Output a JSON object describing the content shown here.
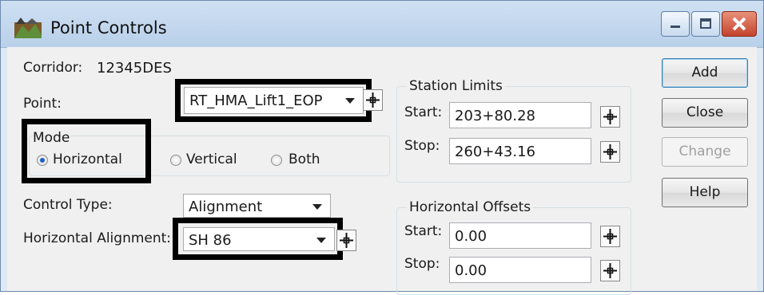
{
  "window": {
    "title": "Point Controls",
    "icon": "microstation-terrain-icon"
  },
  "corridor": {
    "label": "Corridor:",
    "value": "12345DES"
  },
  "point": {
    "label": "Point:",
    "value": "RT_HMA_Lift1_EOP"
  },
  "mode": {
    "title": "Mode",
    "options": [
      "Horizontal",
      "Vertical",
      "Both"
    ],
    "selected": "Horizontal"
  },
  "control_type": {
    "label": "Control Type:",
    "value": "Alignment"
  },
  "horizontal_alignment": {
    "label": "Horizontal Alignment:",
    "value": "SH 86"
  },
  "station_limits": {
    "title": "Station Limits",
    "start_label": "Start:",
    "start_value": "203+80.28",
    "stop_label": "Stop:",
    "stop_value": "260+43.16"
  },
  "horizontal_offsets": {
    "title": "Horizontal Offsets",
    "start_label": "Start:",
    "start_value": "0.00",
    "stop_label": "Stop:",
    "stop_value": "0.00"
  },
  "buttons": {
    "add": "Add",
    "close": "Close",
    "change": "Change",
    "help": "Help"
  },
  "colors": {
    "title_bar": "#c4d8ef",
    "close_button": "#c4432c",
    "radio_selected": "#1d5fc7"
  }
}
